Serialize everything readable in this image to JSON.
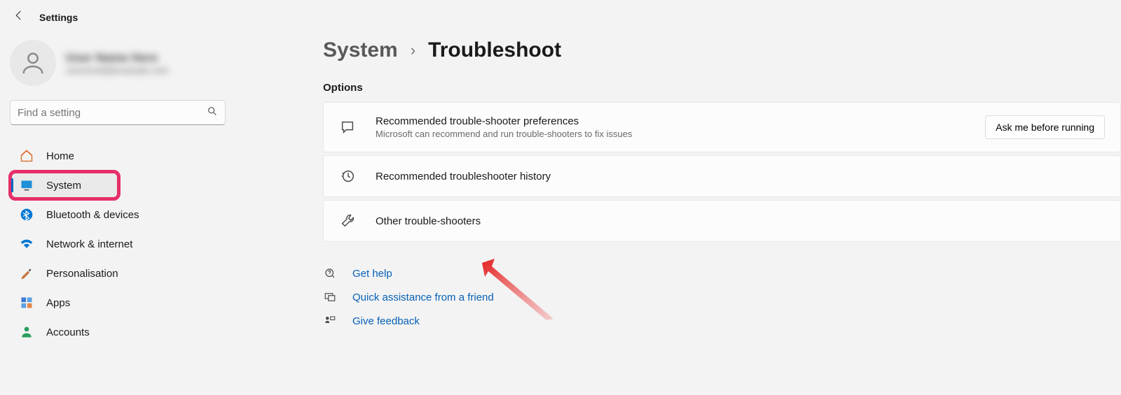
{
  "window_title": "Settings",
  "profile": {
    "name": "User Name Here",
    "email": "useremail@example.com"
  },
  "search": {
    "placeholder": "Find a setting"
  },
  "sidebar": {
    "items": [
      {
        "label": "Home"
      },
      {
        "label": "System"
      },
      {
        "label": "Bluetooth & devices"
      },
      {
        "label": "Network & internet"
      },
      {
        "label": "Personalisation"
      },
      {
        "label": "Apps"
      },
      {
        "label": "Accounts"
      }
    ]
  },
  "breadcrumb": {
    "parent": "System",
    "current": "Troubleshoot"
  },
  "options_label": "Options",
  "cards": {
    "recommended": {
      "title": "Recommended trouble-shooter preferences",
      "sub": "Microsoft can recommend and run trouble-shooters to fix issues",
      "action": "Ask me before running"
    },
    "history": {
      "title": "Recommended troubleshooter history"
    },
    "other": {
      "title": "Other trouble-shooters"
    }
  },
  "links": {
    "help": "Get help",
    "assist": "Quick assistance from a friend",
    "feedback": "Give feedback"
  }
}
